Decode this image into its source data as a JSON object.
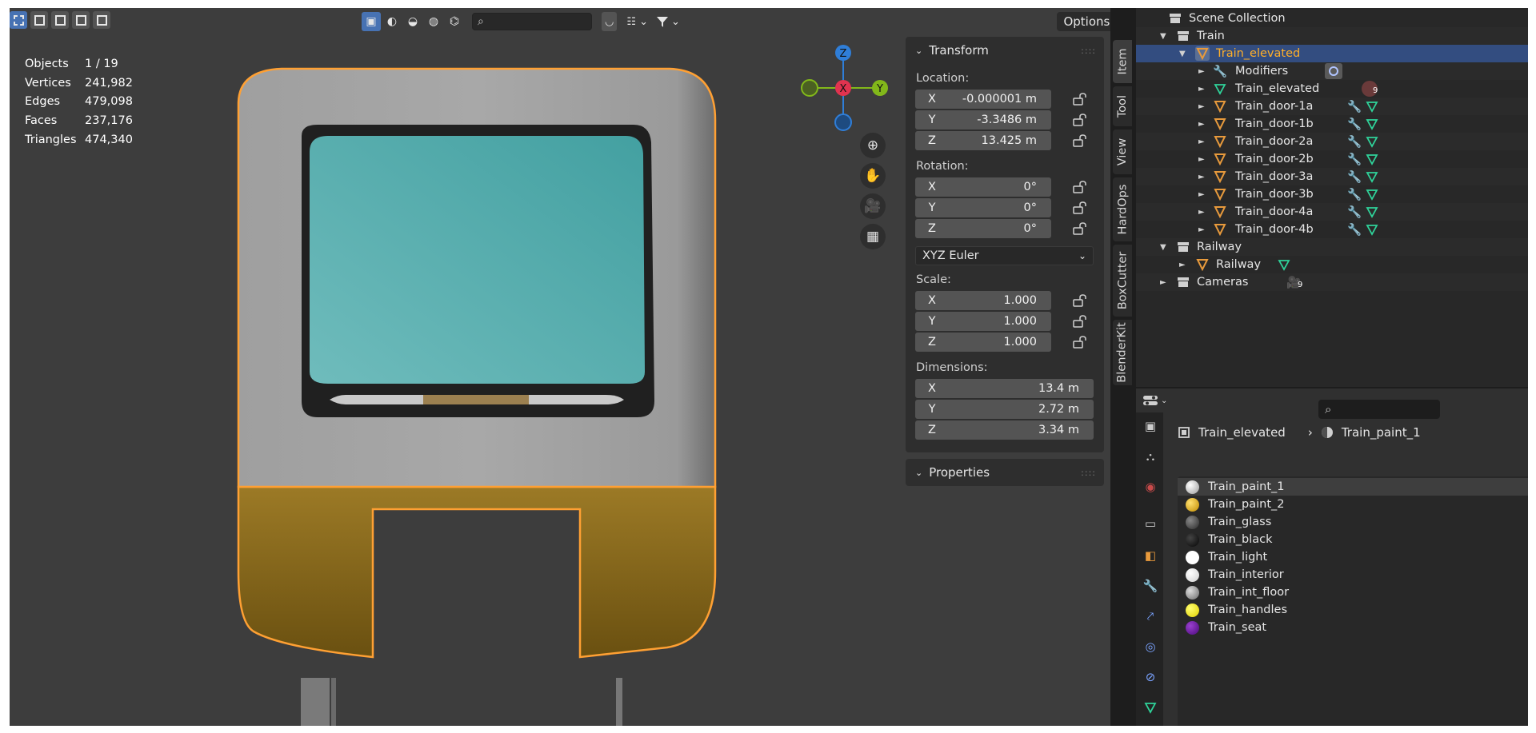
{
  "stats": {
    "rows": [
      {
        "label": "Objects",
        "value": "1 / 19"
      },
      {
        "label": "Vertices",
        "value": "241,982"
      },
      {
        "label": "Edges",
        "value": "479,098"
      },
      {
        "label": "Faces",
        "value": "237,176"
      },
      {
        "label": "Triangles",
        "value": "474,340"
      }
    ]
  },
  "viewport": {
    "options_label": "Options",
    "gizmo": {
      "x": "X",
      "y": "Y",
      "z": "Z"
    },
    "search_placeholder": ""
  },
  "npanel": {
    "transform_title": "Transform",
    "location_label": "Location:",
    "location": [
      {
        "axis": "X",
        "value": "-0.000001 m"
      },
      {
        "axis": "Y",
        "value": "-3.3486 m"
      },
      {
        "axis": "Z",
        "value": "13.425 m"
      }
    ],
    "rotation_label": "Rotation:",
    "rotation": [
      {
        "axis": "X",
        "value": "0°"
      },
      {
        "axis": "Y",
        "value": "0°"
      },
      {
        "axis": "Z",
        "value": "0°"
      }
    ],
    "rotation_mode": "XYZ Euler",
    "scale_label": "Scale:",
    "scale": [
      {
        "axis": "X",
        "value": "1.000"
      },
      {
        "axis": "Y",
        "value": "1.000"
      },
      {
        "axis": "Z",
        "value": "1.000"
      }
    ],
    "dimensions_label": "Dimensions:",
    "dimensions": [
      {
        "axis": "X",
        "value": "13.4 m"
      },
      {
        "axis": "Y",
        "value": "2.72 m"
      },
      {
        "axis": "Z",
        "value": "3.34 m"
      }
    ],
    "properties_title": "Properties"
  },
  "tabs": [
    "Item",
    "Tool",
    "View",
    "HardOps",
    "BoxCutter",
    "BlenderKit"
  ],
  "outliner": {
    "scene_collection": "Scene Collection",
    "train": "Train",
    "train_elevated": "Train_elevated",
    "modifiers": "Modifiers",
    "mesh_name": "Train_elevated",
    "mesh_badge": "9",
    "doors": [
      "Train_door-1a",
      "Train_door-1b",
      "Train_door-2a",
      "Train_door-2b",
      "Train_door-3a",
      "Train_door-3b",
      "Train_door-4a",
      "Train_door-4b"
    ],
    "railway_collection": "Railway",
    "railway_object": "Railway",
    "cameras_collection": "Cameras",
    "cameras_badge": "9"
  },
  "properties": {
    "search_placeholder": "",
    "breadcrumb_object": "Train_elevated",
    "breadcrumb_material": "Train_paint_1",
    "materials": [
      {
        "name": "Train_paint_1",
        "color": "#d9d9d9"
      },
      {
        "name": "Train_paint_2",
        "color": "#d6a21c"
      },
      {
        "name": "Train_glass",
        "color": "#555555"
      },
      {
        "name": "Train_black",
        "color": "#111111"
      },
      {
        "name": "Train_light",
        "color": "#ffffff"
      },
      {
        "name": "Train_interior",
        "color": "#eeeeee"
      },
      {
        "name": "Train_int_floor",
        "color": "#9a9a9a"
      },
      {
        "name": "Train_handles",
        "color": "#f2e600"
      },
      {
        "name": "Train_seat",
        "color": "#6b1a9c"
      }
    ]
  },
  "colors": {
    "selection_outline": "#ffa033",
    "window_glass": "#4fa7a7",
    "body_paint": "#a5a5a5",
    "lower_paint": "#8c6a14",
    "axis_x": "#e0334f",
    "axis_y": "#82b81a",
    "axis_z": "#2f7ed8"
  }
}
